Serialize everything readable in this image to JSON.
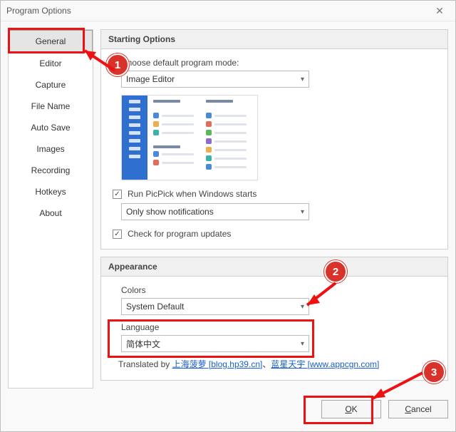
{
  "window": {
    "title": "Program Options"
  },
  "sidebar": {
    "items": [
      {
        "label": "General",
        "active": true
      },
      {
        "label": "Editor"
      },
      {
        "label": "Capture"
      },
      {
        "label": "File Name"
      },
      {
        "label": "Auto Save"
      },
      {
        "label": "Images"
      },
      {
        "label": "Recording"
      },
      {
        "label": "Hotkeys"
      },
      {
        "label": "About"
      }
    ]
  },
  "starting": {
    "header": "Starting Options",
    "mode_label": "Choose default program mode:",
    "mode_value": "Image Editor",
    "run_on_start": {
      "checked": true,
      "label": "Run PicPick when Windows starts"
    },
    "notify_value": "Only show notifications",
    "check_updates": {
      "checked": true,
      "label": "Check for program updates"
    }
  },
  "appearance": {
    "header": "Appearance",
    "colors_label": "Colors",
    "colors_value": "System Default",
    "language_label": "Language",
    "language_value": "简体中文",
    "translated_prefix": "Translated by  ",
    "translated_link1_text": "上海菠萝 [blog.hp39.cn]",
    "translated_sep": "、",
    "translated_link2_text": "蓝星天宇 [www.appcgn.com]"
  },
  "footer": {
    "ok_prefix": "O",
    "ok_accel": "K",
    "cancel_accel": "C",
    "cancel_rest": "ancel"
  }
}
